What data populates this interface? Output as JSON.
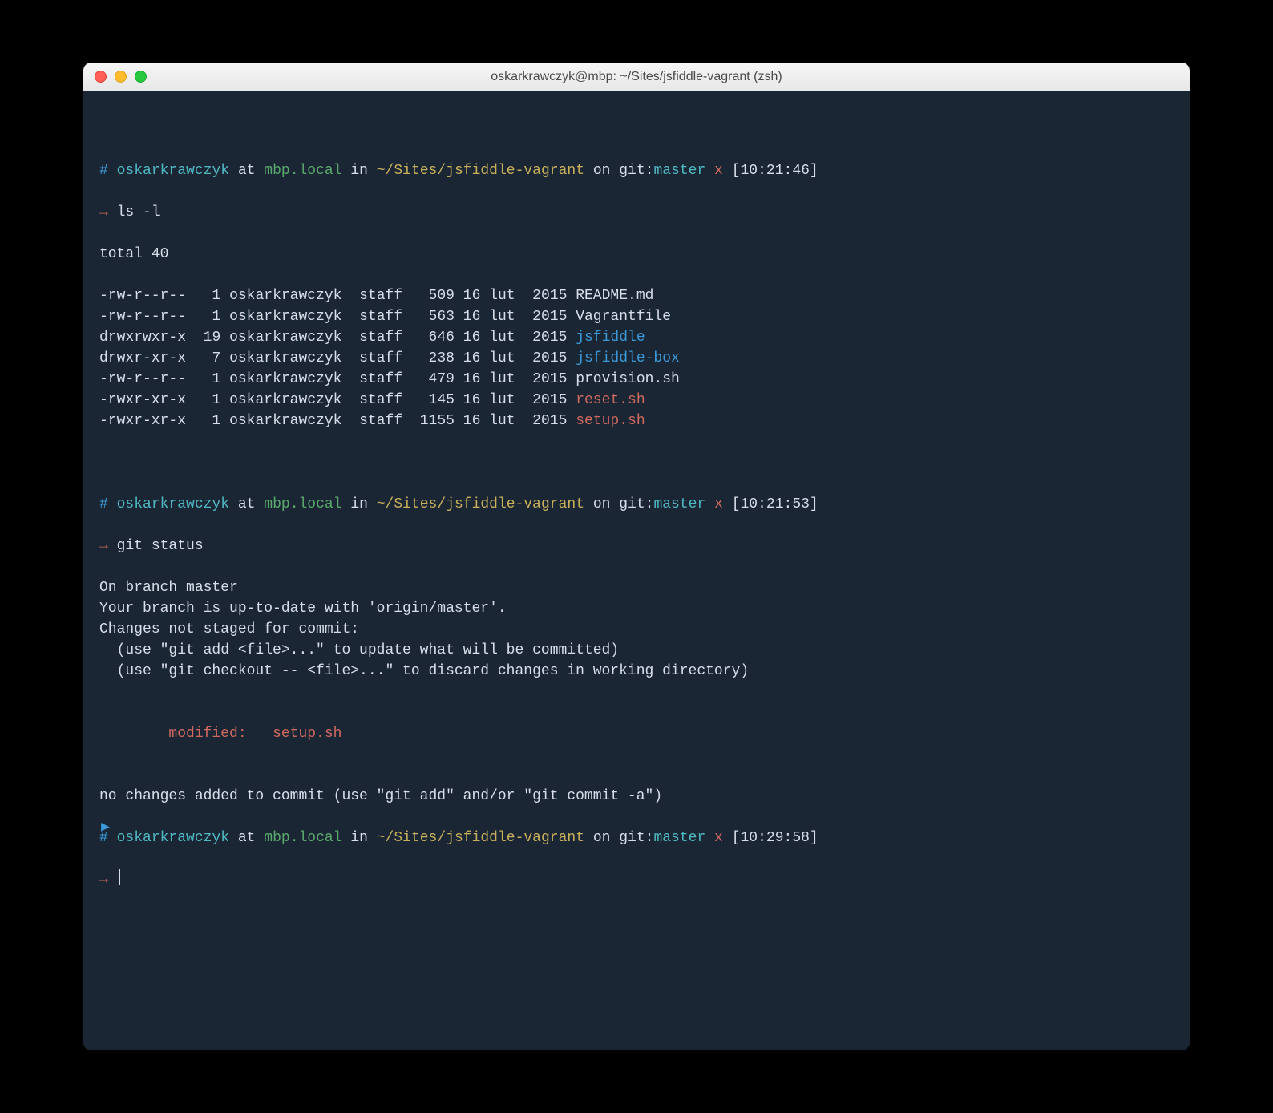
{
  "window": {
    "title": "oskarkrawczyk@mbp: ~/Sites/jsfiddle-vagrant (zsh)"
  },
  "prompts": [
    {
      "hash": "#",
      "user": "oskarkrawczyk",
      "at": "at",
      "host": "mbp.local",
      "in": "in",
      "path": "~/Sites/jsfiddle-vagrant",
      "on": "on",
      "git_label": "git:",
      "branch": "master",
      "dirty": "x",
      "time": "[10:21:46]",
      "arrow": "→",
      "command": "ls -l"
    },
    {
      "hash": "#",
      "user": "oskarkrawczyk",
      "at": "at",
      "host": "mbp.local",
      "in": "in",
      "path": "~/Sites/jsfiddle-vagrant",
      "on": "on",
      "git_label": "git:",
      "branch": "master",
      "dirty": "x",
      "time": "[10:21:53]",
      "arrow": "→",
      "command": "git status"
    },
    {
      "hash": "#",
      "user": "oskarkrawczyk",
      "at": "at",
      "host": "mbp.local",
      "in": "in",
      "path": "~/Sites/jsfiddle-vagrant",
      "on": "on",
      "git_label": "git:",
      "branch": "master",
      "dirty": "x",
      "time": "[10:29:58]",
      "arrow": "→",
      "command": ""
    }
  ],
  "ls": {
    "total": "total 40",
    "rows": [
      {
        "perm": "-rw-r--r--",
        "links": "  1",
        "owner": "oskarkrawczyk",
        "group": "staff",
        "size": "  509",
        "date": "16 lut  2015",
        "name": "README.md",
        "color": "c-white"
      },
      {
        "perm": "-rw-r--r--",
        "links": "  1",
        "owner": "oskarkrawczyk",
        "group": "staff",
        "size": "  563",
        "date": "16 lut  2015",
        "name": "Vagrantfile",
        "color": "c-white"
      },
      {
        "perm": "drwxrwxr-x",
        "links": " 19",
        "owner": "oskarkrawczyk",
        "group": "staff",
        "size": "  646",
        "date": "16 lut  2015",
        "name": "jsfiddle",
        "color": "c-blue"
      },
      {
        "perm": "drwxr-xr-x",
        "links": "  7",
        "owner": "oskarkrawczyk",
        "group": "staff",
        "size": "  238",
        "date": "16 lut  2015",
        "name": "jsfiddle-box",
        "color": "c-blue"
      },
      {
        "perm": "-rw-r--r--",
        "links": "  1",
        "owner": "oskarkrawczyk",
        "group": "staff",
        "size": "  479",
        "date": "16 lut  2015",
        "name": "provision.sh",
        "color": "c-white"
      },
      {
        "perm": "-rwxr-xr-x",
        "links": "  1",
        "owner": "oskarkrawczyk",
        "group": "staff",
        "size": "  145",
        "date": "16 lut  2015",
        "name": "reset.sh",
        "color": "c-red"
      },
      {
        "perm": "-rwxr-xr-x",
        "links": "  1",
        "owner": "oskarkrawczyk",
        "group": "staff",
        "size": " 1155",
        "date": "16 lut  2015",
        "name": "setup.sh",
        "color": "c-red"
      }
    ]
  },
  "git_status": {
    "lines_pre": [
      "On branch master",
      "Your branch is up-to-date with 'origin/master'.",
      "Changes not staged for commit:",
      "  (use \"git add <file>...\" to update what will be committed)",
      "  (use \"git checkout -- <file>...\" to discard changes in working directory)",
      ""
    ],
    "modified_label": "        modified:   ",
    "modified_file": "setup.sh",
    "lines_post": [
      "",
      "no changes added to commit (use \"git add\" and/or \"git commit -a\")"
    ]
  },
  "marker": "▶"
}
